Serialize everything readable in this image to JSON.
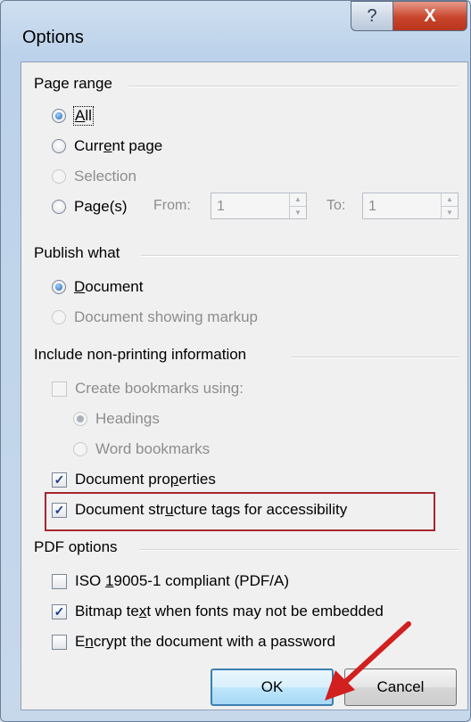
{
  "window": {
    "title": "Options",
    "help_glyph": "?",
    "close_glyph": "X"
  },
  "page_range": {
    "label": "Page range",
    "all_a": "A",
    "all_b": "ll",
    "current_a": "Curr",
    "current_u": "e",
    "current_b": "nt page",
    "selection": "Selection",
    "pages_a": "Pa",
    "pages_u": "g",
    "pages_b": "e(s)",
    "from_label": "From:",
    "from_value": "1",
    "to_label": "To:",
    "to_value": "1"
  },
  "publish_what": {
    "label": "Publish what",
    "document_u": "D",
    "document_b": "ocument",
    "markup": "Document showing markup"
  },
  "nonprinting": {
    "label": "Include non-printing information",
    "bookmarks": "Create bookmarks using:",
    "headings": "Headings",
    "word_bookmarks": "Word bookmarks",
    "props_a": "Document pro",
    "props_u": "p",
    "props_b": "erties",
    "tags_a": "Document str",
    "tags_u": "u",
    "tags_b": "cture tags for accessibility"
  },
  "pdf_options": {
    "label": "PDF options",
    "iso_a": "ISO ",
    "iso_u": "1",
    "iso_b": "9005-1 compliant (PDF/A)",
    "bitmap_a": "Bitmap te",
    "bitmap_u": "x",
    "bitmap_b": "t when fonts may not be embedded",
    "encrypt_a": "E",
    "encrypt_u": "n",
    "encrypt_b": "crypt the document with a password"
  },
  "buttons": {
    "ok": "OK",
    "cancel": "Cancel"
  },
  "check_glyph": "✓",
  "colors": {
    "highlight_box": "#a7262d",
    "annotation_arrow": "#d21f1f"
  }
}
